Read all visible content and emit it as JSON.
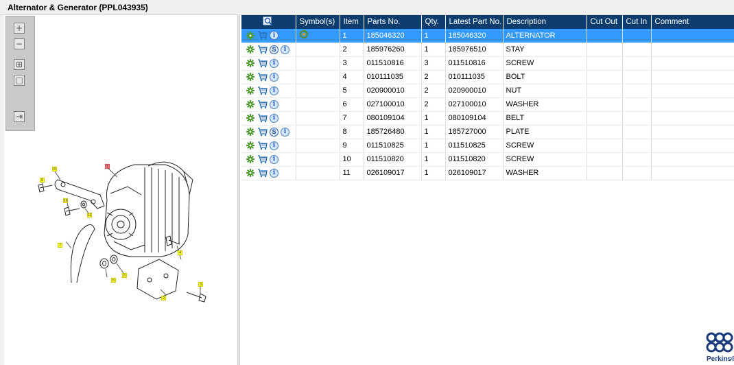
{
  "window": {
    "title": "Alternator & Generator (PPL043935)"
  },
  "toolbar": {
    "buttons": [
      {
        "name": "zoom-in",
        "glyph": "+"
      },
      {
        "name": "zoom-out",
        "glyph": "−"
      },
      {
        "name": "fit-all",
        "glyph": "⊞"
      },
      {
        "name": "actual-size",
        "glyph": "□"
      },
      {
        "name": "export",
        "glyph": "⇥"
      }
    ]
  },
  "diagram": {
    "callouts": [
      "1",
      "2",
      "3",
      "4",
      "5",
      "6",
      "7",
      "8",
      "9",
      "10",
      "11"
    ]
  },
  "table": {
    "headers": {
      "symbols": "Symbol(s)",
      "item": "Item",
      "parts_no": "Parts No.",
      "qty": "Qty.",
      "latest": "Latest Part No.",
      "description": "Description",
      "cut_out": "Cut Out",
      "cut_in": "Cut In",
      "comment": "Comment"
    },
    "rows": [
      {
        "item": "1",
        "parts_no": "185046320",
        "qty": "1",
        "latest": "185046320",
        "description": "ALTERNATOR",
        "s_icon": false,
        "symbol": true,
        "selected": true
      },
      {
        "item": "2",
        "parts_no": "185976260",
        "qty": "1",
        "latest": "185976510",
        "description": "STAY",
        "s_icon": true,
        "symbol": false,
        "selected": false
      },
      {
        "item": "3",
        "parts_no": "011510816",
        "qty": "3",
        "latest": "011510816",
        "description": "SCREW",
        "s_icon": false,
        "symbol": false,
        "selected": false
      },
      {
        "item": "4",
        "parts_no": "010111035",
        "qty": "2",
        "latest": "010111035",
        "description": "BOLT",
        "s_icon": false,
        "symbol": false,
        "selected": false
      },
      {
        "item": "5",
        "parts_no": "020900010",
        "qty": "2",
        "latest": "020900010",
        "description": "NUT",
        "s_icon": false,
        "symbol": false,
        "selected": false
      },
      {
        "item": "6",
        "parts_no": "027100010",
        "qty": "2",
        "latest": "027100010",
        "description": "WASHER",
        "s_icon": false,
        "symbol": false,
        "selected": false
      },
      {
        "item": "7",
        "parts_no": "080109104",
        "qty": "1",
        "latest": "080109104",
        "description": "BELT",
        "s_icon": false,
        "symbol": false,
        "selected": false
      },
      {
        "item": "8",
        "parts_no": "185726480",
        "qty": "1",
        "latest": "185727000",
        "description": "PLATE",
        "s_icon": true,
        "symbol": false,
        "selected": false
      },
      {
        "item": "9",
        "parts_no": "011510825",
        "qty": "1",
        "latest": "011510825",
        "description": "SCREW",
        "s_icon": false,
        "symbol": false,
        "selected": false
      },
      {
        "item": "10",
        "parts_no": "011510820",
        "qty": "1",
        "latest": "011510820",
        "description": "SCREW",
        "s_icon": false,
        "symbol": false,
        "selected": false
      },
      {
        "item": "11",
        "parts_no": "026109017",
        "qty": "1",
        "latest": "026109017",
        "description": "WASHER",
        "s_icon": false,
        "symbol": false,
        "selected": false
      }
    ]
  },
  "brand": {
    "name": "Perkins®",
    "color": "#1b3a7a"
  },
  "colors": {
    "header_bg": "#0d3d6f",
    "selected_row": "#3399ff",
    "callout": "#ffff33"
  }
}
